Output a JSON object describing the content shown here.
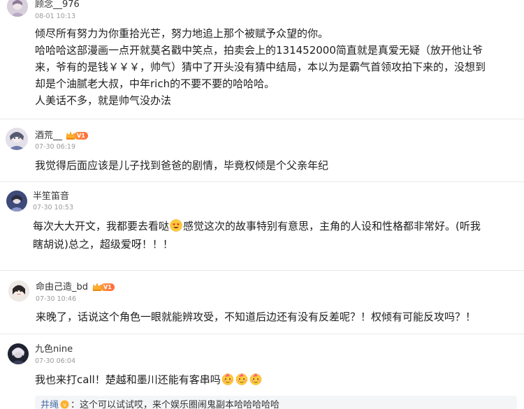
{
  "comments": [
    {
      "username": "顾念__976",
      "time": "08-01 10:13",
      "lines": [
        "倾尽所有努力为你重拾光芒，努力地追上那个被赋予众望的你。",
        "哈哈哈这部漫画一点开就莫名戳中笑点，拍卖会上的131452000简直就是真爱无疑（放开他让爷",
        "来，爷有的是钱￥￥￥，帅气）猜中了开头没有猜中结局，本以为是霸气首领攻拍下来的，没想到",
        "却是个油腻老大叔，中年rich的不要不要的哈哈哈。",
        "人美话不多，就是帅气没办法"
      ]
    },
    {
      "username": "酒荒__",
      "badge": "V1",
      "time": "07-30 06:19",
      "lines": [
        "我觉得后面应该是儿子找到爸爸的剧情，毕竟权倾是个父亲年纪"
      ]
    },
    {
      "username": "半笙笛音",
      "time": "07-30 10:53",
      "line1_before": "每次大大开文，我都要去看哒",
      "line1_after": "感觉这次的故事特别有意思，主角的人设和性格都非常好。(听我",
      "line2": "瞎胡说)总之，超级爱呀！！！"
    },
    {
      "username": "命由己造_bd",
      "badge": "V1",
      "time": "07-30 10:46",
      "lines": [
        "来晚了，话说这个角色一眼就能辨攻受，不知道后边还有没有反差呢？！权倾有可能反攻吗？！"
      ]
    },
    {
      "username": "九色nine",
      "time": "07-30 06:04",
      "text_before": "我也来打call！楚越和墨川还能有客串吗"
    }
  ],
  "reply": {
    "username": "井绳",
    "text": "：这个可以试试哎，来个娱乐圈闹鬼副本哈哈哈哈哈"
  },
  "icons": {
    "badge_crown": "crown-icon",
    "heart_eyes": "heart-eyes-emoji",
    "party_face": "party-face-emoji",
    "vip_badge": "vip-level-icon"
  },
  "colors": {
    "badge_orange": "#ff8a3d",
    "reply_user": "#4a6fa8",
    "divider": "#e8e8e8"
  }
}
